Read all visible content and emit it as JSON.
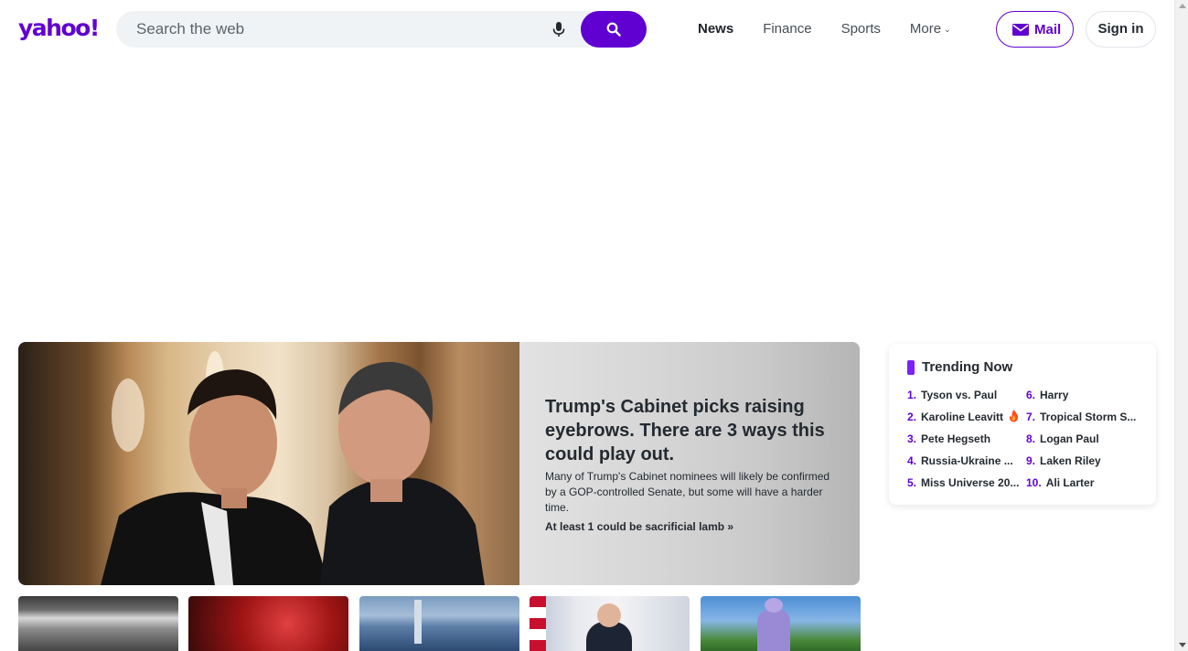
{
  "header": {
    "logo": "yahoo!",
    "search_placeholder": "Search the web",
    "nav": [
      {
        "label": "News",
        "active": true
      },
      {
        "label": "Finance",
        "active": false
      },
      {
        "label": "Sports",
        "active": false
      },
      {
        "label": "More",
        "active": false
      }
    ],
    "mail_label": "Mail",
    "signin_label": "Sign in"
  },
  "hero": {
    "title": "Trump's Cabinet picks raising eyebrows. There are 3 ways this could play out.",
    "summary": "Many of Trump's Cabinet nominees will likely be confirmed by a GOP-controlled Senate, but some will have a harder time.",
    "link": "At least 1 could be sacrificial lamb »"
  },
  "trending": {
    "title": "Trending Now",
    "items": [
      {
        "rank": "1.",
        "label": "Tyson vs. Paul"
      },
      {
        "rank": "2.",
        "label": "Karoline Leavitt",
        "hot": true
      },
      {
        "rank": "3.",
        "label": "Pete Hegseth"
      },
      {
        "rank": "4.",
        "label": "Russia-Ukraine ..."
      },
      {
        "rank": "5.",
        "label": "Miss Universe 20..."
      },
      {
        "rank": "6.",
        "label": "Harry"
      },
      {
        "rank": "7.",
        "label": "Tropical Storm S..."
      },
      {
        "rank": "8.",
        "label": "Logan Paul"
      },
      {
        "rank": "9.",
        "label": "Laken Riley"
      },
      {
        "rank": "10.",
        "label": "Ali Larter"
      }
    ]
  },
  "colors": {
    "brand": "#6001d2",
    "trend_accent": "#7e1fff"
  }
}
